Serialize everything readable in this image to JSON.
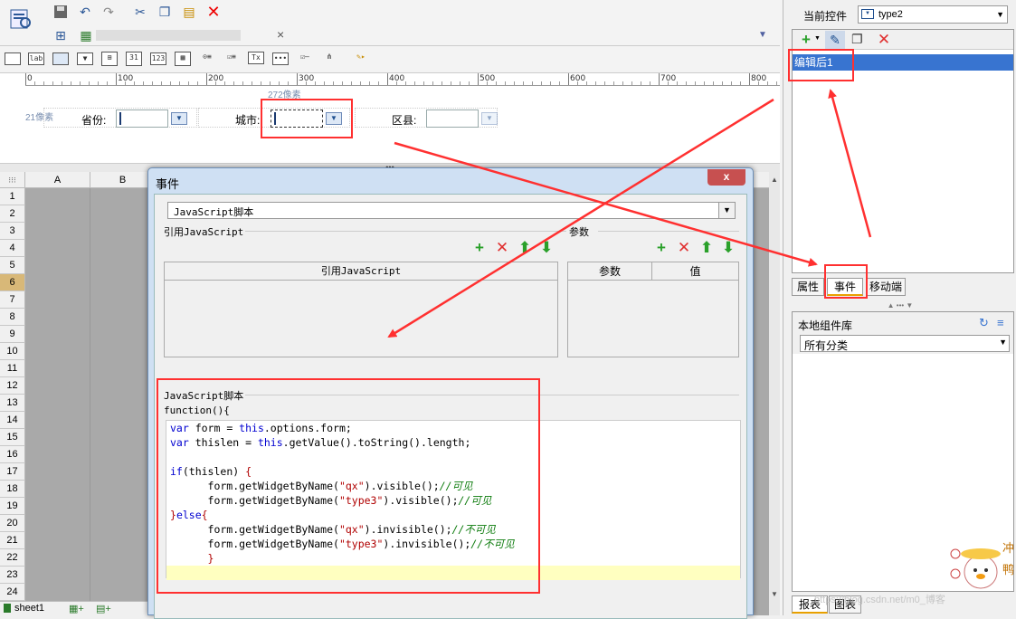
{
  "toolbar": {
    "tab_close": "×"
  },
  "designer": {
    "ruler_labels": [
      "0",
      "100",
      "200",
      "300",
      "400",
      "500",
      "600",
      "700",
      "800"
    ],
    "width_hint": "272像素",
    "height_hint": "21像素",
    "labels": {
      "province": "省份:",
      "city": "城市:",
      "district": "区县:"
    }
  },
  "sheet": {
    "columns": [
      "A",
      "B"
    ],
    "rows": [
      "1",
      "2",
      "3",
      "4",
      "5",
      "6",
      "7",
      "8",
      "9",
      "10",
      "11",
      "12",
      "13",
      "14",
      "15",
      "16",
      "17",
      "18",
      "19",
      "20",
      "21",
      "22",
      "23",
      "24"
    ],
    "tab": "sheet1"
  },
  "dialog": {
    "title": "事件",
    "close": "x",
    "type_select": "JavaScript脚本",
    "ref_section": "引用JavaScript",
    "param_section": "参数",
    "ref_table_header": "引用JavaScript",
    "param_col1": "参数",
    "param_col2": "值",
    "script_section": "JavaScript脚本",
    "function_header": "function(){",
    "code": [
      {
        "parts": [
          {
            "t": "var",
            "c": "kw"
          },
          {
            "t": " form = ",
            "c": ""
          },
          {
            "t": "this",
            "c": "kw"
          },
          {
            "t": ".options.form;",
            "c": ""
          }
        ]
      },
      {
        "parts": [
          {
            "t": "var",
            "c": "kw"
          },
          {
            "t": " thislen = ",
            "c": ""
          },
          {
            "t": "this",
            "c": "kw"
          },
          {
            "t": ".getValue().toString().length;",
            "c": ""
          }
        ]
      },
      {
        "parts": []
      },
      {
        "parts": [
          {
            "t": "if",
            "c": "kw"
          },
          {
            "t": "(thislen) ",
            "c": ""
          },
          {
            "t": "{",
            "c": "str"
          }
        ]
      },
      {
        "parts": [
          {
            "t": "      form.getWidgetByName(",
            "c": ""
          },
          {
            "t": "\"qx\"",
            "c": "str"
          },
          {
            "t": ").visible();",
            "c": ""
          },
          {
            "t": "//可见",
            "c": "cmt"
          }
        ]
      },
      {
        "parts": [
          {
            "t": "      form.getWidgetByName(",
            "c": ""
          },
          {
            "t": "\"type3\"",
            "c": "str"
          },
          {
            "t": ").visible();",
            "c": ""
          },
          {
            "t": "//可见",
            "c": "cmt"
          }
        ]
      },
      {
        "parts": [
          {
            "t": "}",
            "c": "str"
          },
          {
            "t": "else",
            "c": "kw"
          },
          {
            "t": "{",
            "c": "str"
          }
        ]
      },
      {
        "parts": [
          {
            "t": "      form.getWidgetByName(",
            "c": ""
          },
          {
            "t": "\"qx\"",
            "c": "str"
          },
          {
            "t": ").invisible();",
            "c": ""
          },
          {
            "t": "//不可见",
            "c": "cmt"
          }
        ]
      },
      {
        "parts": [
          {
            "t": "      form.getWidgetByName(",
            "c": ""
          },
          {
            "t": "\"type3\"",
            "c": "str"
          },
          {
            "t": ").invisible();",
            "c": ""
          },
          {
            "t": "//不可见",
            "c": "cmt"
          }
        ]
      },
      {
        "parts": [
          {
            "t": "      }",
            "c": "str"
          }
        ]
      }
    ]
  },
  "right_panel": {
    "current_control_label": "当前控件",
    "current_control_value": "type2",
    "event_item": "编辑后1",
    "tabs": [
      "属性",
      "事件",
      "移动端"
    ],
    "lib_title": "本地组件库",
    "lib_category": "所有分类",
    "bottom_tabs": [
      "报表",
      "图表"
    ]
  },
  "watermark": "https://blog.csdn.net/m0_博客",
  "colors": {
    "annotation": "#ff3030",
    "selection": "#3874d0",
    "code_highlight": "#ffffc0"
  }
}
